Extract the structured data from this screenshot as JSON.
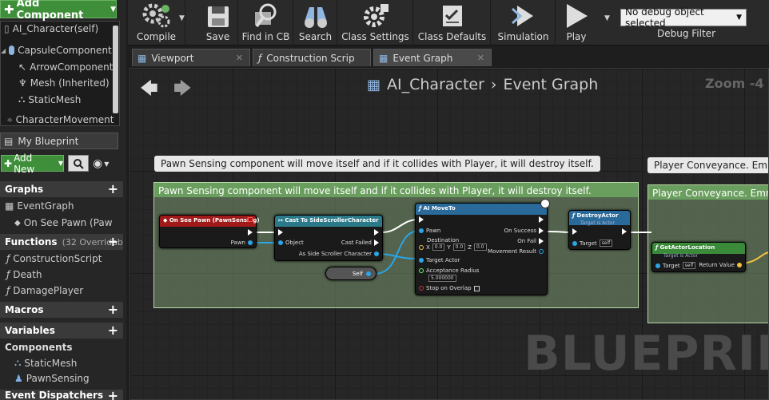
{
  "components_panel": {
    "add_component": "Add Component",
    "tree": [
      "AI_Character(self)",
      "CapsuleComponent",
      "ArrowComponent",
      "Mesh (Inherited)",
      "StaticMesh",
      "CharacterMovement"
    ]
  },
  "my_blueprint": {
    "tab_label": "My Blueprint",
    "add_new": "Add New",
    "sections": {
      "graphs": "Graphs",
      "functions": "Functions",
      "functions_count": "(32 Overridab",
      "macros": "Macros",
      "variables": "Variables",
      "components": "Components",
      "event_dispatchers": "Event Dispatchers"
    },
    "graphs_items": [
      "EventGraph",
      "On See Pawn (Paw"
    ],
    "functions_items": [
      "ConstructionScript",
      "Death",
      "DamagePlayer"
    ],
    "components_items": [
      "StaticMesh",
      "PawnSensing"
    ]
  },
  "toolbar": {
    "compile": "Compile",
    "save": "Save",
    "find_in_cb": "Find in CB",
    "search": "Search",
    "class_settings": "Class Settings",
    "class_defaults": "Class Defaults",
    "simulation": "Simulation",
    "play": "Play",
    "debug_select": "No debug object selected",
    "debug_filter": "Debug Filter"
  },
  "tabs": [
    "Viewport",
    "Construction Scrip",
    "Event Graph"
  ],
  "graph": {
    "breadcrumb_root": "AI_Character",
    "breadcrumb_sep": "›",
    "breadcrumb_current": "Event Graph",
    "zoom": "Zoom -4",
    "watermark": "BLUEPRINT",
    "bubble1": "Pawn Sensing component will move itself and if it collides with Player, it will destroy itself.",
    "comment1": "Pawn Sensing component will move itself and if it collides with Player, it will destroy itself.",
    "bubble2": "Player Conveyance. Emm",
    "comment2": "Player Conveyance. Emm",
    "nodes": {
      "on_see_pawn": {
        "title": "On See Pawn (PawnSensing)",
        "pin_pawn": "Pawn"
      },
      "cast": {
        "title": "Cast To SideScrollerCharacter",
        "pin_object": "Object",
        "pin_failed": "Cast Failed",
        "pin_as": "As Side Scroller Character"
      },
      "self_node": {
        "label": "Self"
      },
      "ai_move": {
        "title": "AI MoveTo",
        "pin_pawn": "Pawn",
        "pin_dest": "Destination",
        "dest_x": "0.0",
        "dest_y": "0.0",
        "dest_z": "0.0",
        "pin_target": "Target Actor",
        "pin_radius": "Acceptance Radius",
        "radius_val": "5.000000",
        "pin_overlap": "Stop on Overlap",
        "out_success": "On Success",
        "out_fail": "On Fail",
        "out_result": "Movement Result",
        "axis_x": "X",
        "axis_y": "Y",
        "axis_z": "Z"
      },
      "destroy": {
        "title": "DestroyActor",
        "sub": "Target is Actor",
        "pin_target": "Target",
        "self_tag": "self"
      },
      "get_loc": {
        "title": "GetActorLocation",
        "sub": "Target is Actor",
        "pin_target": "Target",
        "self_tag": "self",
        "out_ret": "Return Value"
      }
    }
  }
}
